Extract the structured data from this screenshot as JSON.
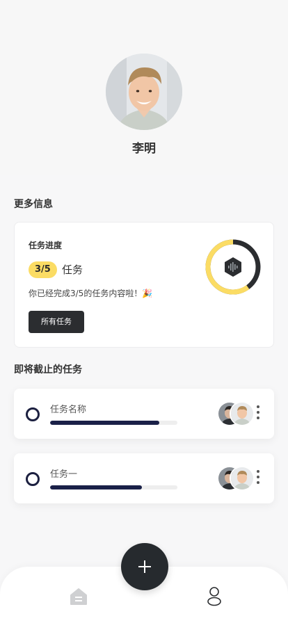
{
  "profile": {
    "name": "李明"
  },
  "more_info": {
    "title": "更多信息"
  },
  "progress_card": {
    "title": "任务进度",
    "count": "3/5",
    "count_label": "任务",
    "description": "你已经完成3/5的任务内容啦！🎉",
    "button_label": "所有任务",
    "progress": 0.6,
    "ring_colors": {
      "done": "#fbdc64",
      "remaining": "#2b2d30"
    }
  },
  "upcoming": {
    "title": "即将截止的任务",
    "tasks": [
      {
        "name": "任务名称",
        "progress": 0.86
      },
      {
        "name": "任务一",
        "progress": 0.72
      }
    ]
  },
  "icons": {
    "fab": "plus-icon",
    "nav_home": "home-icon",
    "nav_profile": "person-icon",
    "task_more": "more-vertical-icon",
    "ring_center": "audio-wave-icon"
  },
  "colors": {
    "accent_yellow": "#fbdc64",
    "dark": "#262a2e",
    "progress_navy": "#1a2048"
  }
}
